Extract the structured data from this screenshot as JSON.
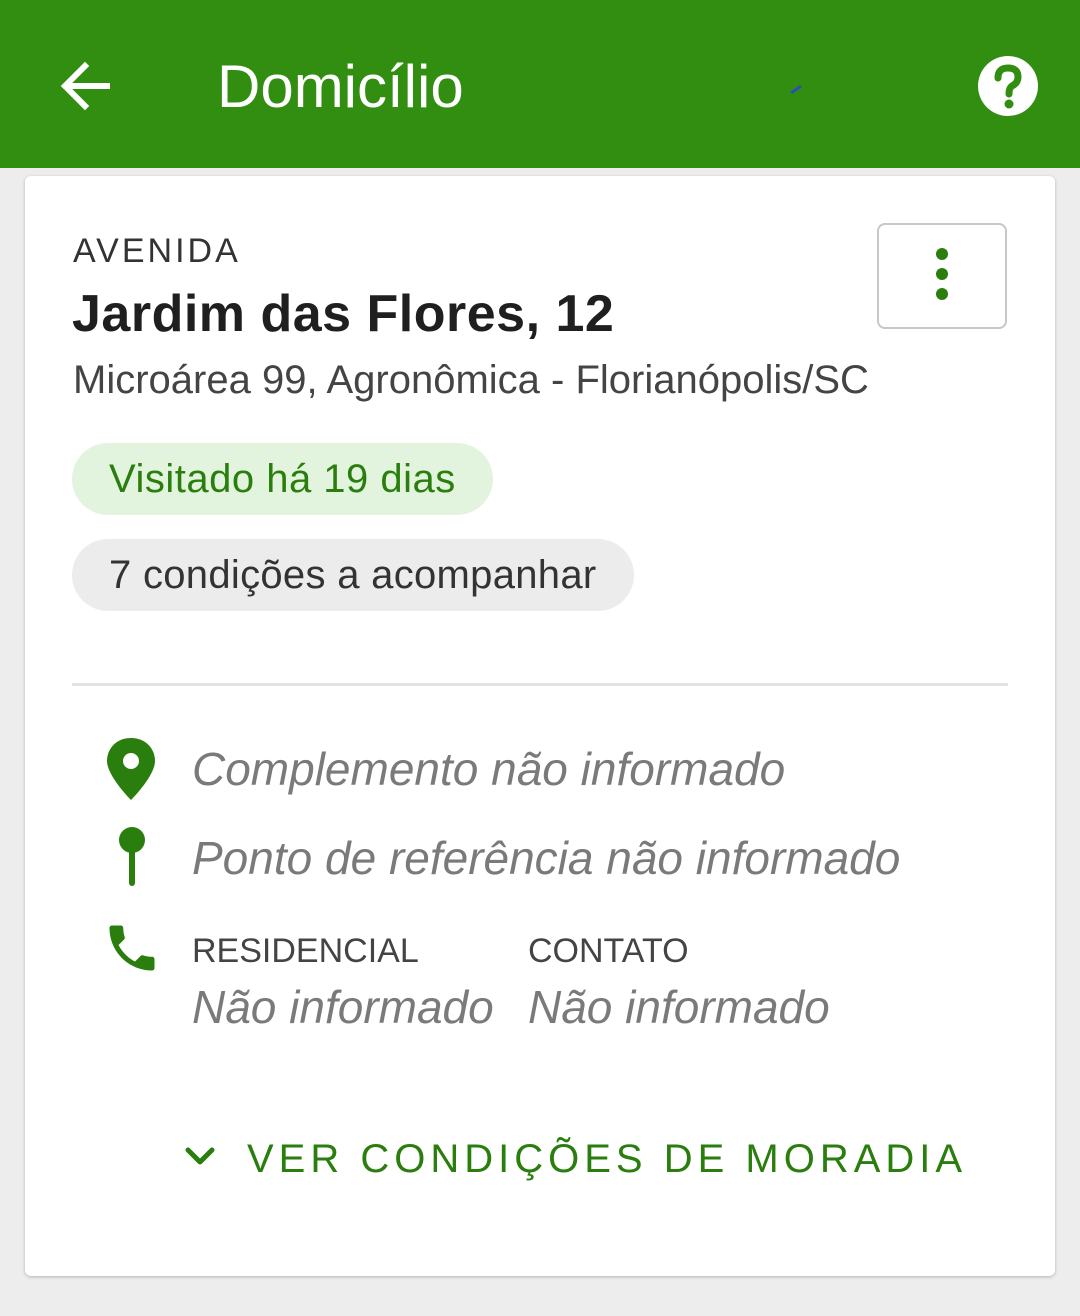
{
  "appbar": {
    "title": "Domicílio",
    "back_icon": "arrow-back-icon",
    "help_icon": "help-circle-icon",
    "color": "#318e11"
  },
  "address": {
    "street_type": "AVENIDA",
    "street_name": "Jardim das Flores, 12",
    "locality": "Microárea 99, Agronômica - Florianópolis/SC",
    "menu_icon": "more-vertical-icon"
  },
  "chips": {
    "visited": "Visitado há 19 dias",
    "conditions": "7 condições a acompanhar"
  },
  "details": {
    "complement": "Complemento não informado",
    "reference": "Ponto de referência não informado",
    "phones": [
      {
        "label": "RESIDENCIAL",
        "value": "Não informado"
      },
      {
        "label": "CONTATO",
        "value": "Não informado"
      }
    ]
  },
  "expand": {
    "label": "VER CONDIÇÕES DE MORADIA",
    "icon": "chevron-down-icon"
  },
  "colors": {
    "accent": "#2a7e0d",
    "chip_visited_bg": "#e3f4de",
    "chip_neutral_bg": "#ececec"
  }
}
